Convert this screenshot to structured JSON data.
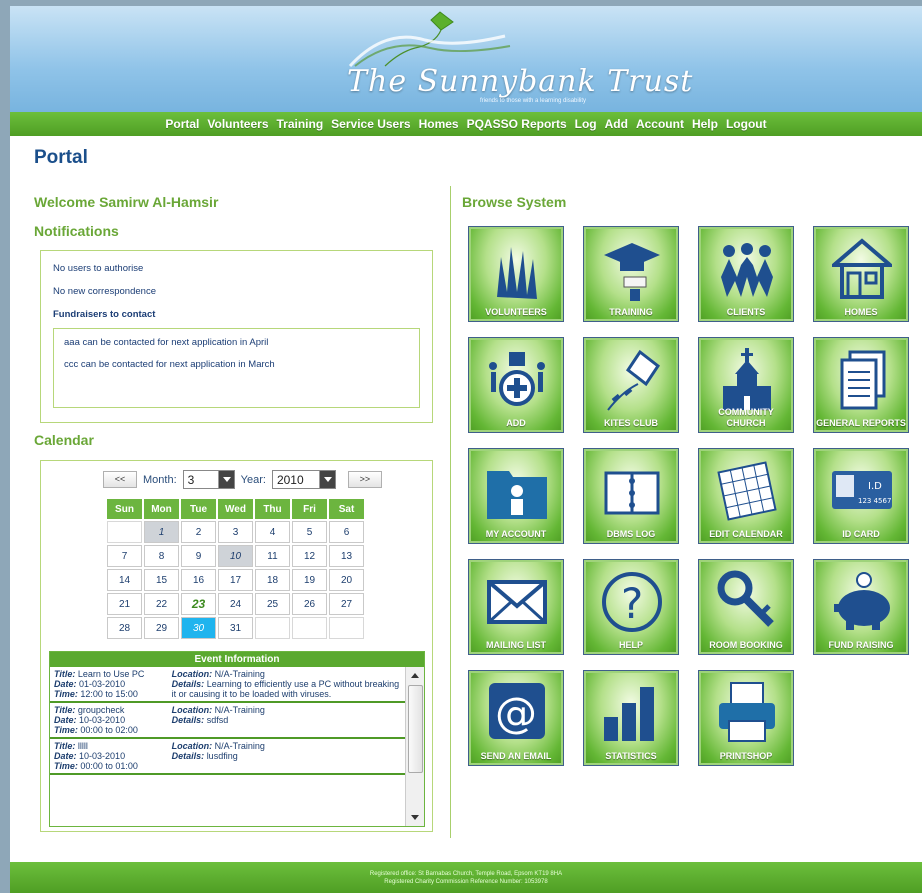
{
  "brand": {
    "logo_text": "The Sunnybank Trust",
    "tagline": "friends to those with a learning disability"
  },
  "nav": [
    "Portal",
    "Volunteers",
    "Training",
    "Service Users",
    "Homes",
    "PQASSO Reports",
    "Log",
    "Add",
    "Account",
    "Help",
    "Logout"
  ],
  "page_title": "Portal",
  "welcome": "Welcome Samirw Al-Hamsir",
  "notifications": {
    "heading": "Notifications",
    "items": [
      "No users to authorise",
      "No new correspondence"
    ],
    "fundraisers_heading": "Fundraisers to contact",
    "fundraisers": [
      "aaa can be contacted for next application in April",
      "ccc can be contacted for next application in March"
    ]
  },
  "calendar": {
    "heading": "Calendar",
    "prev_label": "<<",
    "next_label": ">>",
    "month_label": "Month:",
    "month_value": "3",
    "year_label": "Year:",
    "year_value": "2010",
    "weekdays": [
      "Sun",
      "Mon",
      "Tue",
      "Wed",
      "Thu",
      "Fri",
      "Sat"
    ],
    "weeks": [
      [
        "",
        "1",
        "2",
        "3",
        "4",
        "5",
        "6"
      ],
      [
        "7",
        "8",
        "9",
        "10",
        "11",
        "12",
        "13"
      ],
      [
        "14",
        "15",
        "16",
        "17",
        "18",
        "19",
        "20"
      ],
      [
        "21",
        "22",
        "23",
        "24",
        "25",
        "26",
        "27"
      ],
      [
        "28",
        "29",
        "30",
        "31",
        "",
        "",
        ""
      ]
    ],
    "event_days": [
      "1",
      "10"
    ],
    "today": "23",
    "selected": "30"
  },
  "events": {
    "heading": "Event Information",
    "labels": {
      "title": "Title:",
      "date": "Date:",
      "time": "Time:",
      "location": "Location:",
      "details": "Details:"
    },
    "items": [
      {
        "title": "Learn to Use PC",
        "date": "01-03-2010",
        "time": "12:00 to 15:00",
        "location": "N/A-Training",
        "details": "Learning to efficiently use a PC without breaking it or causing it to be loaded with viruses."
      },
      {
        "title": "groupcheck",
        "date": "10-03-2010",
        "time": "00:00 to 02:00",
        "location": "N/A-Training",
        "details": "sdfsd"
      },
      {
        "title": "lllll",
        "date": "10-03-2010",
        "time": "00:00 to 01:00",
        "location": "N/A-Training",
        "details": "lusdfing"
      }
    ]
  },
  "browse": {
    "heading": "Browse System",
    "tiles": [
      {
        "label": "VOLUNTEERS",
        "icon": "hands-raised-icon"
      },
      {
        "label": "TRAINING",
        "icon": "graduation-cap-icon"
      },
      {
        "label": "CLIENTS",
        "icon": "people-group-icon"
      },
      {
        "label": "HOMES",
        "icon": "house-icon"
      },
      {
        "label": "ADD",
        "icon": "add-person-icon"
      },
      {
        "label": "KITES CLUB",
        "icon": "kite-icon"
      },
      {
        "label": "COMMUNITY CHURCH",
        "icon": "church-icon"
      },
      {
        "label": "GENERAL REPORTS",
        "icon": "documents-icon"
      },
      {
        "label": "MY ACCOUNT",
        "icon": "user-folder-icon"
      },
      {
        "label": "DBMS LOG",
        "icon": "binder-icon"
      },
      {
        "label": "EDIT CALENDAR",
        "icon": "calendar-icon"
      },
      {
        "label": "ID CARD",
        "icon": "id-card-icon"
      },
      {
        "label": "MAILING LIST",
        "icon": "envelope-icon"
      },
      {
        "label": "HELP",
        "icon": "question-icon"
      },
      {
        "label": "ROOM BOOKING",
        "icon": "key-icon"
      },
      {
        "label": "FUND RAISING",
        "icon": "piggy-bank-icon"
      },
      {
        "label": "SEND AN EMAIL",
        "icon": "at-sign-icon"
      },
      {
        "label": "STATISTICS",
        "icon": "bar-chart-icon"
      },
      {
        "label": "PRINTSHOP",
        "icon": "printer-icon"
      }
    ]
  },
  "footer": {
    "line1": "Registered office: St Barnabas Church, Temple Road, Epsom KT19 8HA",
    "line2": "Registered Charity Commission Reference Number: 1053978"
  },
  "colors": {
    "green_bar": "#5aa92f",
    "heading_green": "#6aa737",
    "title_blue": "#1b4f8b",
    "text_blue": "#1d3e6e",
    "selected_day": "#1fb4ee"
  }
}
